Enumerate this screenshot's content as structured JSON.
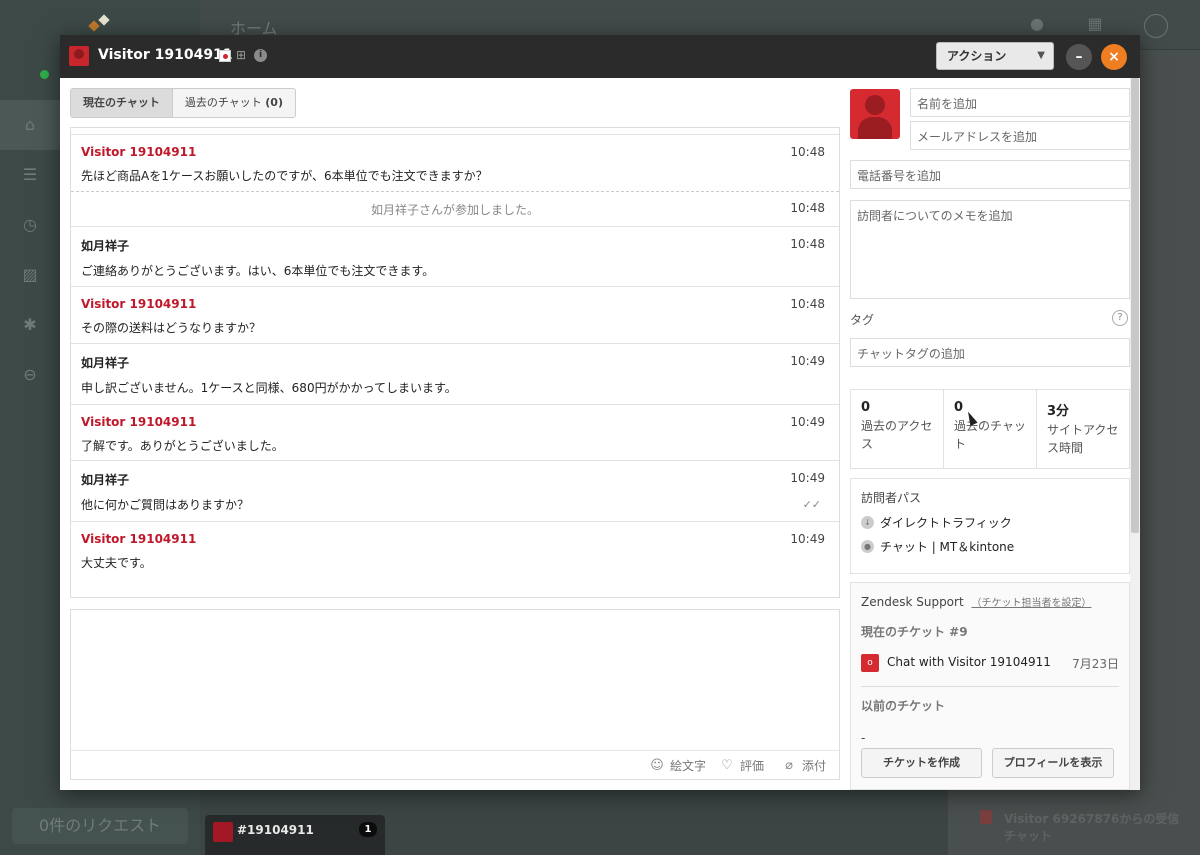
{
  "background": {
    "page_title": "ホーム",
    "requests_label": "0件のリクエスト",
    "chat_tab": {
      "label": "#19104911",
      "count": "1"
    },
    "right_fragments": [
      "Visitor 69267876からの受信",
      "チャット"
    ]
  },
  "modal": {
    "title": "Visitor 19104911",
    "action_label": "アクション",
    "minimize_label": "–",
    "close_label": "×",
    "tabs": [
      {
        "label": "現在のチャット",
        "count": ""
      },
      {
        "label": "過去のチャット",
        "count": "(0)"
      }
    ],
    "messages": [
      {
        "type": "msg",
        "author": "Visitor 19104911",
        "role": "visitor",
        "time": "10:48",
        "text": "先ほど商品Aを1ケースお願いしたのですが、6本単位でも注文できますか？"
      },
      {
        "type": "system",
        "text": "如月祥子さんが参加しました。",
        "time": "10:48"
      },
      {
        "type": "msg",
        "author": "如月祥子",
        "role": "agent",
        "time": "10:48",
        "text": "ご連絡ありがとうございます。はい、6本単位でも注文できます。"
      },
      {
        "type": "msg",
        "author": "Visitor 19104911",
        "role": "visitor",
        "time": "10:48",
        "text": "その際の送料はどうなりますか？"
      },
      {
        "type": "msg",
        "author": "如月祥子",
        "role": "agent",
        "time": "10:49",
        "text": "申し訳ございません。1ケースと同様、680円がかかってしまいます。"
      },
      {
        "type": "msg",
        "author": "Visitor 19104911",
        "role": "visitor",
        "time": "10:49",
        "text": "了解です。ありがとうございました。"
      },
      {
        "type": "msg",
        "author": "如月祥子",
        "role": "agent",
        "time": "10:49",
        "text": "他に何かご質問はありますか？"
      },
      {
        "type": "msg",
        "author": "Visitor 19104911",
        "role": "visitor",
        "time": "10:49",
        "text": "大丈夫です。"
      }
    ],
    "composer": {
      "emoji_label": "絵文字",
      "rate_label": "評価",
      "attach_label": "添付"
    },
    "visitor": {
      "name_placeholder": "名前を追加",
      "email_placeholder": "メールアドレスを追加",
      "phone_placeholder": "電話番号を追加",
      "notes_placeholder": "訪問者についてのメモを追加",
      "tags_label": "タグ",
      "tags_placeholder": "チャットタグの追加",
      "stats": [
        {
          "value": "0",
          "caption": "過去のアクセス"
        },
        {
          "value": "0",
          "caption": "過去のチャット"
        },
        {
          "value": "3分",
          "caption": "サイトアクセス時間"
        }
      ],
      "path_title": "訪問者パス",
      "path": [
        "ダイレクトトラフィック",
        "チャット | MT＆kintone"
      ]
    },
    "zendesk": {
      "title": "Zendesk Support",
      "assign_link": "（チケット担当者を設定）",
      "current_label": "現在のチケット #9",
      "ticket_badge": "o",
      "ticket_name": "Chat with Visitor 19104911",
      "ticket_date": "7月23日",
      "previous_label": "以前のチケット",
      "previous_value": "-",
      "create_button": "チケットを作成",
      "profile_button": "プロフィールを表示"
    }
  },
  "colors": {
    "visitor_name": "#c0182b",
    "close_button": "#ef7d22",
    "header": "#2b2b2b"
  }
}
